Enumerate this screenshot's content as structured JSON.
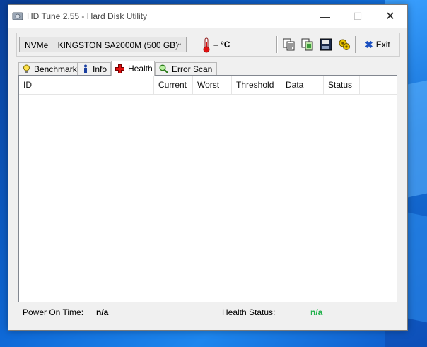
{
  "window": {
    "title": "HD Tune 2.55 - Hard Disk Utility",
    "controls": {
      "minimize": "—",
      "maximize": "☐",
      "close": "✕"
    }
  },
  "toolbar": {
    "drive_value": "NVMe    KINGSTON SA2000M (500 GB)",
    "temperature": "– °C",
    "exit_label": "Exit"
  },
  "tabs": [
    {
      "label": "Benchmark",
      "icon": "bulb-icon"
    },
    {
      "label": "Info",
      "icon": "info-icon"
    },
    {
      "label": "Health",
      "icon": "health-cross-icon",
      "active": true
    },
    {
      "label": "Error Scan",
      "icon": "magnifier-icon"
    }
  ],
  "health_table": {
    "columns": [
      "ID",
      "Current",
      "Worst",
      "Threshold",
      "Data",
      "Status"
    ],
    "rows": []
  },
  "status": {
    "power_on_label": "Power On Time:",
    "power_on_value": "n/a",
    "health_label": "Health Status:",
    "health_value": "n/a"
  },
  "colors": {
    "health_value": "#22b14c",
    "exit_icon": "#1a4fc0",
    "desktop": "#0f6ad8"
  }
}
